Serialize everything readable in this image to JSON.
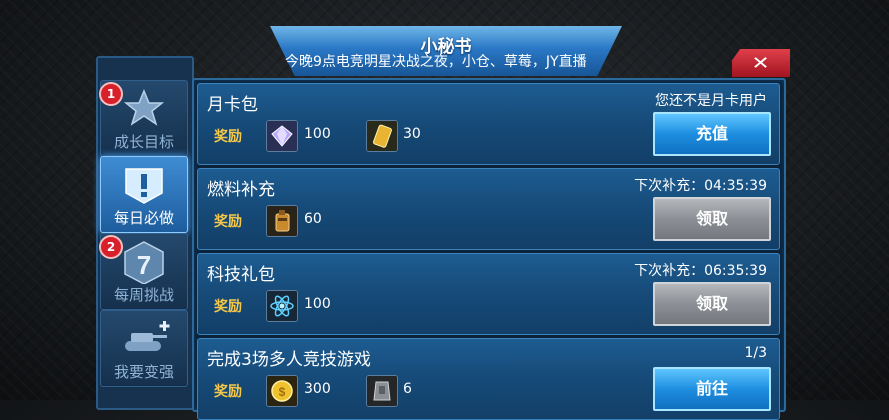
{
  "dialog": {
    "title": "小秘书",
    "marquee": "今晚9点电竞明星决战之夜，小仓、草莓，JY直播"
  },
  "nav": {
    "tabs": [
      {
        "label": "成长目标",
        "badge": "1",
        "icon": "star-trophy-icon",
        "active": false
      },
      {
        "label": "每日必做",
        "badge": "",
        "icon": "exclamation-notice-icon",
        "active": true
      },
      {
        "label": "每周挑战",
        "badge": "2",
        "icon": "number-seven-icon",
        "active": false
      },
      {
        "label": "我要变强",
        "badge": "",
        "icon": "tank-upgrade-icon",
        "active": false
      }
    ]
  },
  "tasks": [
    {
      "title": "月卡包",
      "status": "您还不是月卡用户",
      "reward_label": "奖励",
      "rewards": [
        {
          "icon": "diamond-icon",
          "qty": "100"
        },
        {
          "icon": "gold-card-icon",
          "qty": "30"
        }
      ],
      "button": "充值",
      "button_style": "blue"
    },
    {
      "title": "燃料补充",
      "status": "下次补充：04:35:39",
      "reward_label": "奖励",
      "rewards": [
        {
          "icon": "fuel-can-icon",
          "qty": "60"
        }
      ],
      "button": "领取",
      "button_style": "gray"
    },
    {
      "title": "科技礼包",
      "status": "下次补充：06:35:39",
      "reward_label": "奖励",
      "rewards": [
        {
          "icon": "atom-icon",
          "qty": "100"
        }
      ],
      "button": "领取",
      "button_style": "gray"
    },
    {
      "title": "完成3场多人竞技游戏",
      "status": "1/3",
      "reward_label": "奖励",
      "rewards": [
        {
          "icon": "gold-coin-icon",
          "qty": "300"
        },
        {
          "icon": "armor-part-icon",
          "qty": "6"
        }
      ],
      "button": "前往",
      "button_style": "blue"
    }
  ],
  "colors": {
    "accent_blue": "#1e8ee0",
    "reward_gold": "#f6c84a",
    "close_red": "#d8202a"
  }
}
